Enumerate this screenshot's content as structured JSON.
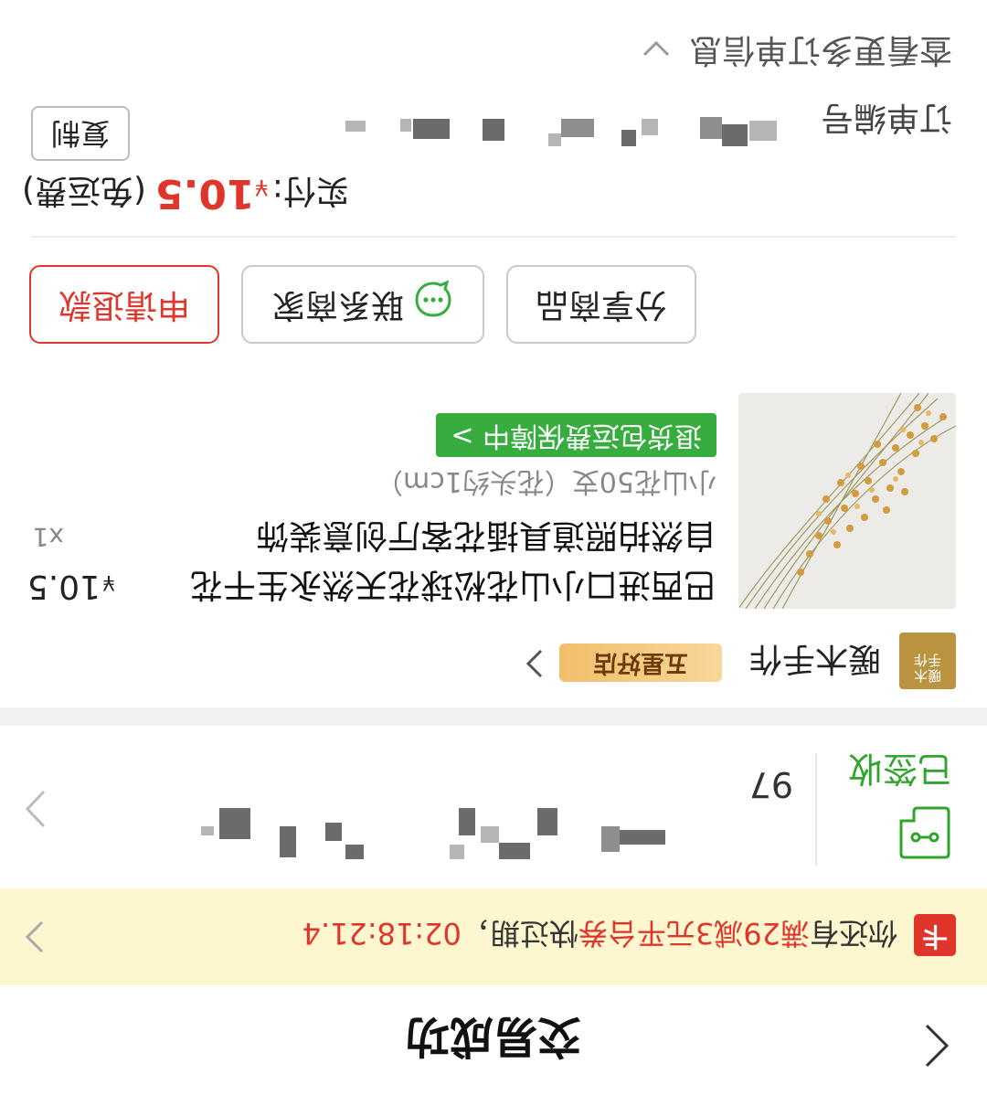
{
  "header": {
    "title": "交易成功"
  },
  "coupon": {
    "badge": "卡",
    "text_prefix": "你还有",
    "text_highlight": "满29减3元平台券",
    "text_middle": "快过期，",
    "countdown": "02:18:21.4"
  },
  "logistics": {
    "status": "已签收",
    "count": "97"
  },
  "shop": {
    "logo_text": "暖木手作",
    "name": "暖木手作",
    "badge": "五星好店"
  },
  "product": {
    "title": "巴西进口小山花松球花天然永生干花自然拍照道具插花客厅创意装饰",
    "sku": "小山花50支（花头约1cm）",
    "guarantee": "退货包运费保障中 >",
    "price_symbol": "¥",
    "price": "10.5",
    "quantity": "x1"
  },
  "actions": {
    "share": "分享商品",
    "contact": "联系商家",
    "refund": "申请退款"
  },
  "payment": {
    "label": "实付:",
    "currency": "¥",
    "amount": "10.5",
    "note": "(免运费)"
  },
  "order": {
    "id_label": "订单编号",
    "copy": "复制",
    "more_info": "查看更多订单信息"
  },
  "colors": {
    "accent_red": "#e0352b",
    "success_green": "#36ad3e",
    "banner_bg": "#fdf6cf",
    "shop_gold": "#b9933f"
  }
}
